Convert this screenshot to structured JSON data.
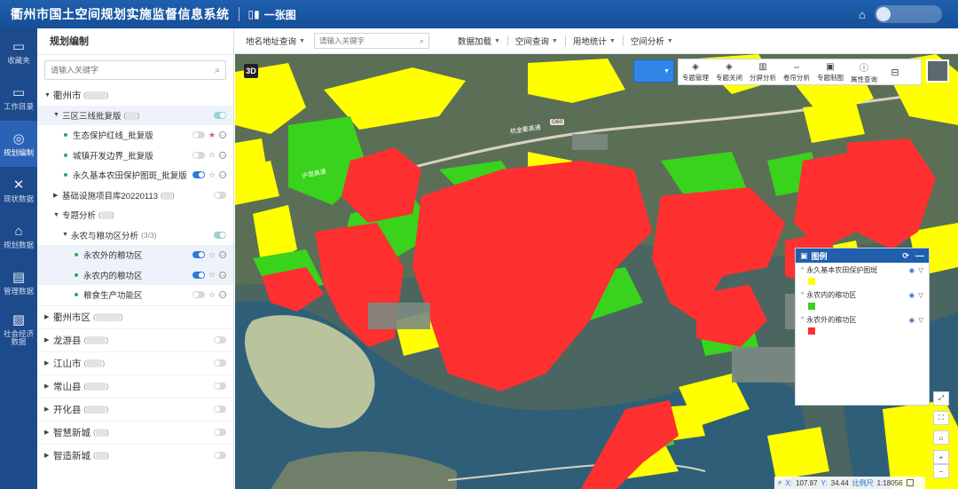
{
  "header": {
    "title": "衢州市国土空间规划实施监督信息系统",
    "map_tab": "一张图"
  },
  "rail": [
    {
      "label": "收藏夹",
      "icon": "folder-icon"
    },
    {
      "label": "工作目录",
      "icon": "folder-icon"
    },
    {
      "label": "规划编制",
      "icon": "compass-icon"
    },
    {
      "label": "现状数据",
      "icon": "tools-icon"
    },
    {
      "label": "规划数据",
      "icon": "home-icon"
    },
    {
      "label": "管理数据",
      "icon": "grid-icon"
    },
    {
      "label": "社会经济数据",
      "icon": "chart-icon"
    }
  ],
  "panel": {
    "title": "规划编制",
    "search_placeholder": "请输入关键字"
  },
  "tree": {
    "city": "衢州市",
    "sanqu": "三区三线批复版",
    "sanqu_items": [
      "生态保护红线_批复版",
      "城镇开发边界_批复版",
      "永久基本农田保护图斑_批复版"
    ],
    "jichu": "基础设施项目库20220113",
    "zhuanti": "专题分析",
    "yongnong": "永农与粮功区分析",
    "yongnong_count": "(3/3)",
    "yongnong_items": [
      "永农外的粮功区",
      "永农内的粮功区",
      "粮食生产功能区"
    ],
    "regions": [
      "衢州市区",
      "龙游县",
      "江山市",
      "常山县",
      "开化县",
      "智慧新城",
      "智造新城"
    ]
  },
  "mapbar": {
    "address_query": "地名地址查询",
    "search_placeholder": "请输入关键字",
    "menus": [
      "数据加载",
      "空间查询",
      "用地统计",
      "空间分析"
    ]
  },
  "map_tools": [
    "专题管理",
    "专题关闭",
    "分屏分析",
    "卷帘分析",
    "专题制图",
    "属性查询"
  ],
  "map_labels": [
    "杭金衢高速",
    "G60",
    "沪昆高速"
  ],
  "legend": {
    "title": "图例",
    "items": [
      {
        "label": "永久基本农田保护图斑",
        "color": "#ffff00"
      },
      {
        "label": "永农内的粮功区",
        "color": "#39d21c"
      },
      {
        "label": "永农外的粮功区",
        "color": "#ff3030"
      }
    ]
  },
  "status": {
    "x_label": "X:",
    "x_value": "107.87",
    "y_label": "Y:",
    "y_value": "34.44",
    "scale_label": "比例尺",
    "scale_value": "1:18056"
  },
  "badge_3d": "3D"
}
